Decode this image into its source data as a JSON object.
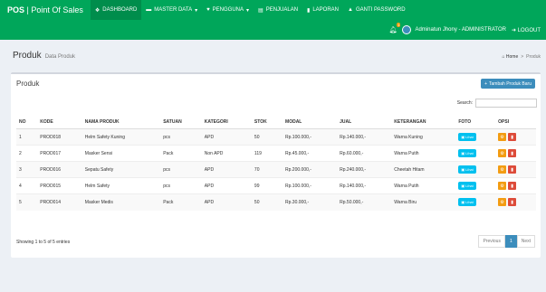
{
  "app": {
    "brand_bold": "POS",
    "brand_rest": " | Point Of Sales"
  },
  "nav": [
    {
      "label": "DASHBOARD",
      "icon": "dashboard-icon",
      "glyph": "❖",
      "active": true
    },
    {
      "label": "MASTER DATA",
      "icon": "folder-icon",
      "glyph": "▬",
      "caret": "▾"
    },
    {
      "label": "PENGGUNA",
      "icon": "users-icon",
      "glyph": "♥",
      "caret": "▾"
    },
    {
      "label": "PENJUALAN",
      "icon": "cart-icon",
      "glyph": "▤"
    },
    {
      "label": "LAPORAN",
      "icon": "file-icon",
      "glyph": "▮"
    },
    {
      "label": "GANTI PASSWORD",
      "icon": "lock-icon",
      "glyph": "▲"
    }
  ],
  "subbar": {
    "notif_count": "1",
    "user": "Adminatun Jhony - ADMINISTRATOR",
    "logout": "LOGOUT"
  },
  "header": {
    "title": "Produk",
    "subtitle": "Data Produk",
    "crumb_home": "Home",
    "crumb_sep": ">",
    "crumb_current": "Produk"
  },
  "box": {
    "title": "Produk",
    "add_label": "Tambah Produk Baru",
    "search_label": "Search:"
  },
  "table": {
    "columns": [
      "NO",
      "KODE",
      "NAMA PRODUK",
      "SATUAN",
      "KATEGORI",
      "STOK",
      "MODAL",
      "JUAL",
      "KETERANGAN",
      "FOTO",
      "OPSI"
    ],
    "rows": [
      [
        "1",
        "PROD018",
        "Helm Safety Kuning",
        "pcs",
        "APD",
        "50",
        "Rp.100.000,-",
        "Rp.140.000,-",
        "Warna Kuning"
      ],
      [
        "2",
        "PROD017",
        "Masker Sensi",
        "Pack",
        "Non APD",
        "119",
        "Rp.45.000,-",
        "Rp.60.000,-",
        "Warna Putih"
      ],
      [
        "3",
        "PROD016",
        "Sepatu Safety",
        "pcs",
        "APD",
        "70",
        "Rp.200.000,-",
        "Rp.240.000,-",
        "Cheetah Hitam"
      ],
      [
        "4",
        "PROD015",
        "Helm Safety",
        "pcs",
        "APD",
        "99",
        "Rp.100.000,-",
        "Rp.140.000,-",
        "Warna Putih"
      ],
      [
        "5",
        "PROD014",
        "Masker Medis",
        "Pack",
        "APD",
        "50",
        "Rp.30.000,-",
        "Rp.50.000,-",
        "Warna Biru"
      ]
    ],
    "foto_label": "Lihat"
  },
  "footer": {
    "info": "Showing 1 to 5 of 5 entries",
    "prev": "Previous",
    "page": "1",
    "next": "Next"
  },
  "colors": {
    "header_green": "#00a65a",
    "primary": "#3c8dbc",
    "info": "#00c0ef",
    "warning": "#f39c12",
    "danger": "#dd4b39"
  }
}
